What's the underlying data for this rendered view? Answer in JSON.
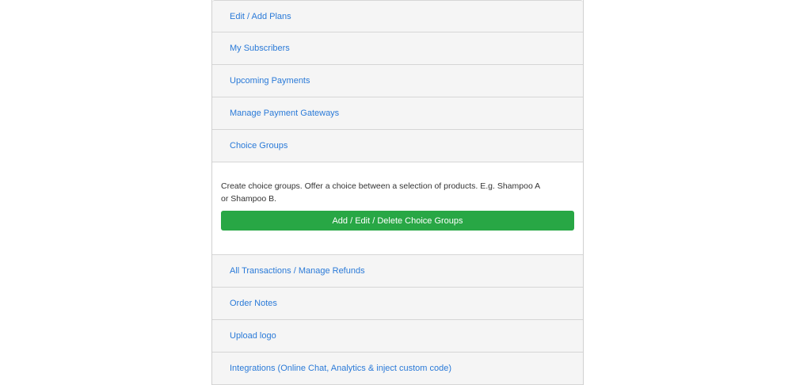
{
  "accordion": {
    "items_before": [
      {
        "label": "Edit / Add Plans"
      },
      {
        "label": "My Subscribers"
      },
      {
        "label": "Upcoming Payments"
      },
      {
        "label": "Manage Payment Gateways"
      },
      {
        "label": "Choice Groups"
      }
    ],
    "open_panel": {
      "description": "Create choice groups. Offer a choice between a selection of products. E.g. Shampoo A or Shampoo B.",
      "button_label": "Add / Edit / Delete Choice Groups"
    },
    "items_after": [
      {
        "label": "All Transactions / Manage Refunds"
      },
      {
        "label": "Order Notes"
      },
      {
        "label": "Upload logo"
      },
      {
        "label": "Integrations (Online Chat, Analytics & inject custom code)"
      }
    ]
  },
  "colors": {
    "link": "#2a7ad8",
    "button": "#28a745",
    "header_bg": "#f5f5f5"
  }
}
